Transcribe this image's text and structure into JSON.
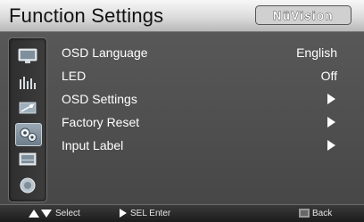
{
  "header": {
    "title": "Function Settings",
    "brand": "NüVision"
  },
  "sidebar": {
    "items": [
      {
        "icon": "monitor-icon",
        "active": false
      },
      {
        "icon": "equalizer-icon",
        "active": false
      },
      {
        "icon": "image-adjust-icon",
        "active": false
      },
      {
        "icon": "function-settings-icon",
        "active": true
      },
      {
        "icon": "input-source-icon",
        "active": false
      },
      {
        "icon": "circle-icon",
        "active": false
      }
    ]
  },
  "menu": {
    "items": [
      {
        "label": "OSD Language",
        "value": "English",
        "submenu": false
      },
      {
        "label": "LED",
        "value": "Off",
        "submenu": false
      },
      {
        "label": "OSD Settings",
        "value": "",
        "submenu": true
      },
      {
        "label": "Factory Reset",
        "value": "",
        "submenu": true
      },
      {
        "label": "Input Label",
        "value": "",
        "submenu": true
      }
    ]
  },
  "help_bar": {
    "select_label": "Select",
    "enter_label": "SEL Enter",
    "back_label": "Back"
  },
  "colors": {
    "title_bar": "#e0e0e0",
    "panel": "#505050",
    "active_icon": "#8a9aa8",
    "text": "#ffffff"
  }
}
